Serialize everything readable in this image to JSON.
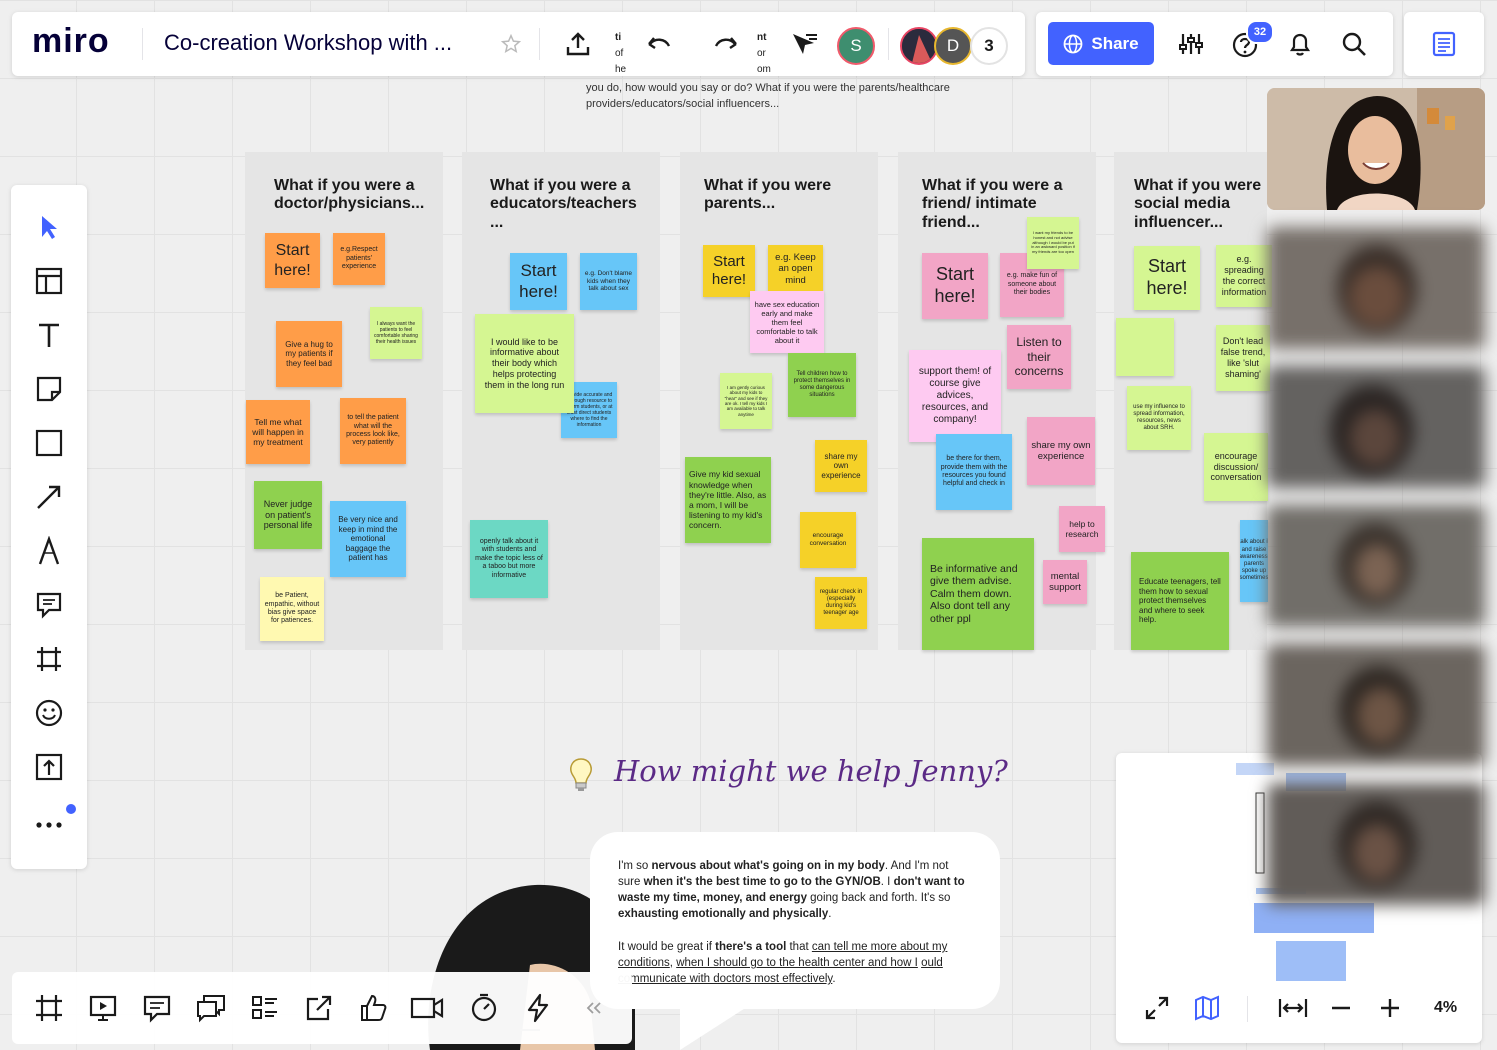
{
  "app": {
    "logo": "miro",
    "board_title": "Co-creation Workshop with ..."
  },
  "topbar": {
    "collaborators": [
      {
        "initial": "S",
        "color": "#3e8e6f"
      },
      {
        "initial": "D",
        "color": "#c9a227"
      }
    ],
    "extra_count": "3",
    "peek_texts": [
      "ti",
      "of",
      "he",
      "nt",
      "or",
      "om"
    ]
  },
  "sharebar": {
    "share_label": "Share",
    "help_badge": "32"
  },
  "prompt_text": "you do, how would you say or do? What if you were the parents/healthcare providers/educators/social influencers...",
  "frames": [
    {
      "title": "What if you were a doctor/physicians...",
      "stickies": [
        {
          "text": "Start here!",
          "color": "c-or"
        },
        {
          "text": "e.g.Respect patients' experience",
          "color": "c-or"
        },
        {
          "text": "I always want the patients to feel comfortable sharing their health issues",
          "color": "c-lg"
        },
        {
          "text": "Give a hug to my patients if they feel bad",
          "color": "c-or"
        },
        {
          "text": "Tell me what will happen in my treatment",
          "color": "c-or"
        },
        {
          "text": "to tell the patient what will the process look like, very patiently",
          "color": "c-or"
        },
        {
          "text": "Never judge on patient's personal life",
          "color": "c-gr"
        },
        {
          "text": "Be very nice and keep in mind the emotional baggage the patient has",
          "color": "c-bl"
        },
        {
          "text": "be Patient, empathic, without bias give space for patiences.",
          "color": "c-yl"
        }
      ]
    },
    {
      "title": "What if you were a educators/teachers ...",
      "stickies": [
        {
          "text": "Start here!",
          "color": "c-bl"
        },
        {
          "text": "e.g. Don't blame kids when they talk about sex",
          "color": "c-bl"
        },
        {
          "text": "I would like to be informative about their body which helps protecting them in the long run",
          "color": "c-lg"
        },
        {
          "text": "provide accurate and thorough resource to inform students, or at least direct students where to find the information",
          "color": "c-bl"
        },
        {
          "text": "openly talk about it with students and make the topic less of a taboo but more informative",
          "color": "c-tl"
        }
      ]
    },
    {
      "title": "What if you were parents...",
      "stickies": [
        {
          "text": "Start here!",
          "color": "c-ys"
        },
        {
          "text": "e.g. Keep an open mind",
          "color": "c-ys"
        },
        {
          "text": "have sex education early and make them feel comfortable to talk about it",
          "color": "c-lp"
        },
        {
          "text": "I am gently curious about my kids to \"hear\" and see if they are ok. I tell my kids I am available to talk anytime",
          "color": "c-lg"
        },
        {
          "text": "Tell children how to protect themselves in some dangerous situations",
          "color": "c-gr"
        },
        {
          "text": "share my own experience",
          "color": "c-ys"
        },
        {
          "text": "Give my kid sexual knowledge when they're little. Also, as a mom, I will be listening to my kid's concern.",
          "color": "c-gr"
        },
        {
          "text": "encourage conversation",
          "color": "c-ys"
        },
        {
          "text": "regular check in (especially during kid's teenager age",
          "color": "c-ys"
        }
      ]
    },
    {
      "title": "What if you were a friend/ intimate friend...",
      "stickies": [
        {
          "text": "Start here!",
          "color": "c-pk"
        },
        {
          "text": "e.g. make fun of someone about their bodies",
          "color": "c-pk"
        },
        {
          "text": "I want my friends to be honest and not advise although I would be put in an awkward position if my friends are too open",
          "color": "c-lg"
        },
        {
          "text": "Listen to their concerns",
          "color": "c-pk"
        },
        {
          "text": "support them! of course give advices, resources, and company!",
          "color": "c-lp"
        },
        {
          "text": "be there for them, provide them with the resources you found helpful and check in",
          "color": "c-bl"
        },
        {
          "text": "share my own experience",
          "color": "c-pk"
        },
        {
          "text": "help to research",
          "color": "c-pk"
        },
        {
          "text": "Be informative and give them advise. Calm them down. Also dont tell any other ppl",
          "color": "c-gr"
        },
        {
          "text": "mental support",
          "color": "c-pk"
        }
      ]
    },
    {
      "title": "What if you were social media influencer...",
      "stickies": [
        {
          "text": "Start here!",
          "color": "c-lg"
        },
        {
          "text": "e.g. spreading the correct information",
          "color": "c-lg"
        },
        {
          "text": "",
          "color": "c-lg"
        },
        {
          "text": "Don't lead false trend, like 'slut shaming'",
          "color": "c-lg"
        },
        {
          "text": "use my influence to spread information, resources, news about SRH.",
          "color": "c-lg"
        },
        {
          "text": "encourage discussion/ conversation",
          "color": "c-lg"
        },
        {
          "text": "talk about it and raise awareness, parents spoke up sometimes",
          "color": "c-bl"
        },
        {
          "text": "Educate teenagers, tell them how to sexual protect themselves and where to seek help.",
          "color": "c-gr"
        }
      ]
    }
  ],
  "hmw": {
    "title": "How might we help Jenny?"
  },
  "quote": {
    "p1": [
      {
        "t": "I'm so ",
        "b": false
      },
      {
        "t": "nervous about what's going on in my body",
        "b": true
      },
      {
        "t": ". And I'm not sure ",
        "b": false
      },
      {
        "t": "when it's the best time to go to the GYN/OB",
        "b": true
      },
      {
        "t": ". I ",
        "b": false
      },
      {
        "t": "don't want to waste my time, money, and energy",
        "b": true
      },
      {
        "t": " going back and forth. It's so ",
        "b": false
      },
      {
        "t": "exhausting emotionally and physically",
        "b": true
      },
      {
        "t": ".",
        "b": false
      }
    ],
    "p2": [
      {
        "t": "It would be great if ",
        "b": false,
        "u": false
      },
      {
        "t": "there's a tool",
        "b": true,
        "u": false
      },
      {
        "t": " that ",
        "b": false,
        "u": false
      },
      {
        "t": "can tell me more about my conditions",
        "b": false,
        "u": true
      },
      {
        "t": ", ",
        "b": false,
        "u": false
      },
      {
        "t": "when I should go to the health center and how I",
        "b": false,
        "u": true
      },
      {
        "t": " ",
        "b": false,
        "u": false
      },
      {
        "t": "ould communicate with doctors most effectively",
        "b": false,
        "u": true
      },
      {
        "t": ".",
        "b": false,
        "u": false
      }
    ]
  },
  "minimap": {
    "zoom_label": "4%"
  },
  "colors": {
    "accent": "#4262ff",
    "brand_ink": "#050038",
    "badge": "#4262ff"
  }
}
